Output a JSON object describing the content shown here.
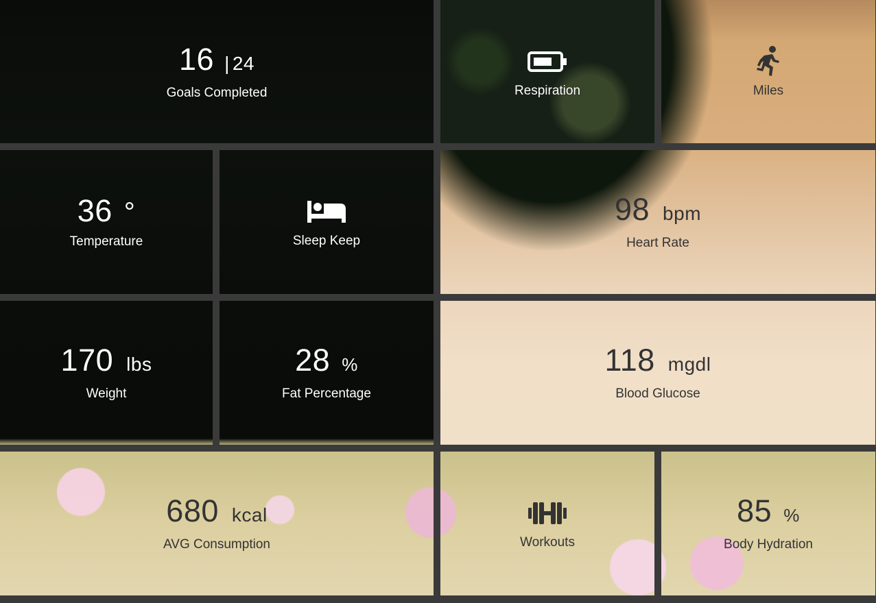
{
  "tiles": {
    "goals": {
      "value": "16",
      "sep": "|",
      "total": "24",
      "label": "Goals Completed"
    },
    "respiration": {
      "icon": "battery-icon",
      "label": "Respiration"
    },
    "miles": {
      "icon": "running-person-icon",
      "label": "Miles"
    },
    "temperature": {
      "value": "36",
      "unit": "°",
      "label": "Temperature"
    },
    "sleep": {
      "icon": "bed-icon",
      "label": "Sleep Keep"
    },
    "heart_rate": {
      "value": "98",
      "unit": "bpm",
      "label": "Heart Rate"
    },
    "weight": {
      "value": "170",
      "unit": "lbs",
      "label": "Weight"
    },
    "fat": {
      "value": "28",
      "unit": "%",
      "label": "Fat Percentage"
    },
    "glucose": {
      "value": "118",
      "unit": "mgdl",
      "label": "Blood Glucose"
    },
    "consumption": {
      "value": "680",
      "unit": "kcal",
      "label": "AVG Consumption"
    },
    "workouts": {
      "icon": "dumbbell-icon",
      "label": "Workouts"
    },
    "hydration": {
      "value": "85",
      "unit": "%",
      "label": "Body Hydration"
    }
  },
  "colors": {
    "gap": "#3a3a3a",
    "text_dark_tile": "#ffffff",
    "text_light_tile": "#333333"
  }
}
